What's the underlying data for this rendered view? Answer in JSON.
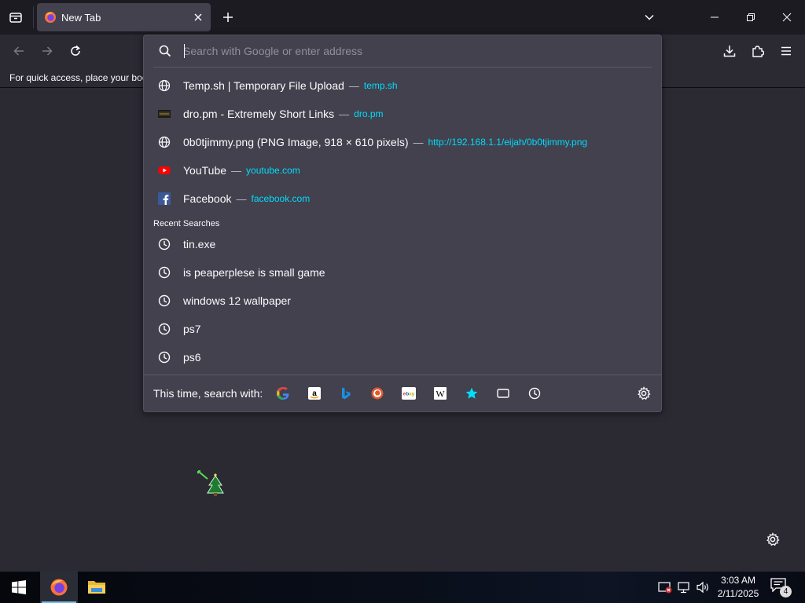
{
  "tab": {
    "title": "New Tab",
    "favicon": "firefox-icon"
  },
  "toolbar": {
    "back": "back-arrow-icon",
    "forward": "forward-arrow-icon",
    "reload": "reload-icon",
    "downloads": "download-icon",
    "extensions": "puzzle-icon",
    "menu": "hamburger-icon"
  },
  "bookmarks_bar": {
    "message": "For quick access, place your boo"
  },
  "urlbar": {
    "placeholder": "Search with Google or enter address",
    "value": ""
  },
  "results": [
    {
      "title": "Temp.sh | Temporary File Upload",
      "separator": "—",
      "url": "temp.sh",
      "icon": "globe-icon"
    },
    {
      "title": "dro.pm - Extremely Short Links",
      "separator": "—",
      "url": "dro.pm",
      "icon": "dro-pm-favicon"
    },
    {
      "title": "0b0tjimmy.png (PNG Image, 918 × 610 pixels)",
      "separator": "—",
      "url": "http://192.168.1.1/eijah/0b0tjimmy.png",
      "icon": "globe-icon"
    },
    {
      "title": "YouTube",
      "separator": "—",
      "url": "youtube.com",
      "icon": "youtube-icon"
    },
    {
      "title": "Facebook",
      "separator": "—",
      "url": "facebook.com",
      "icon": "facebook-icon"
    }
  ],
  "recent_searches": {
    "label": "Recent Searches",
    "items": [
      {
        "text": "tin.exe",
        "icon": "history-icon"
      },
      {
        "text": "is peaperplese is small game",
        "icon": "history-icon"
      },
      {
        "text": "windows 12 wallpaper",
        "icon": "history-icon"
      },
      {
        "text": "ps7",
        "icon": "history-icon"
      },
      {
        "text": "ps6",
        "icon": "history-icon"
      }
    ]
  },
  "one_off": {
    "label": "This time, search with:",
    "engines": [
      "google-icon",
      "amazon-icon",
      "bing-icon",
      "duckduckgo-icon",
      "ebay-icon",
      "wikipedia-icon",
      "bookmarks-star-icon",
      "tabs-icon",
      "history-icon"
    ],
    "settings": "gear-icon"
  },
  "taskbar": {
    "time": "3:03 AM",
    "date": "2/11/2025",
    "notification_count": "4"
  },
  "colors": {
    "accent_url": "#00ddff",
    "panel": "#42414d",
    "background": "#2b2a33",
    "tabstrip": "#1c1b22"
  }
}
